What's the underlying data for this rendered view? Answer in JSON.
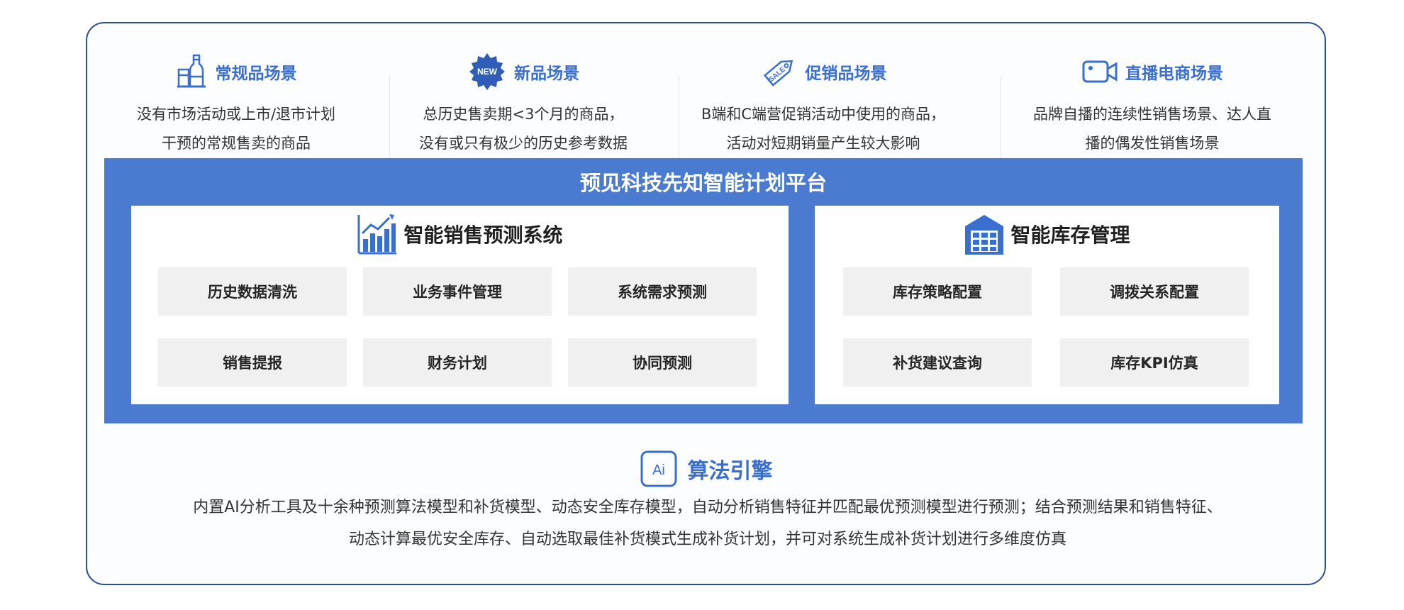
{
  "scenarios": [
    {
      "icon": "bottle-icon",
      "title": "常规品场景",
      "line1": "没有市场活动或上市/退市计划",
      "line2": "干预的常规售卖的商品"
    },
    {
      "icon": "new-badge-icon",
      "badge_text": "NEW",
      "title": "新品场景",
      "line1": "总历史售卖期<3个月的商品，",
      "line2": "没有或只有极少的历史参考数据"
    },
    {
      "icon": "sale-tag-icon",
      "tag_text": "SALE",
      "title": "促销品场景",
      "line1": "B端和C端营促销活动中使用的商品，",
      "line2": "活动对短期销量产生较大影响"
    },
    {
      "icon": "video-camera-icon",
      "title": "直播电商场景",
      "line1": "品牌自播的连续性销售场景、达人直",
      "line2": "播的偶发性销售场景"
    }
  ],
  "platform": {
    "title": "预见科技先知智能计划平台",
    "forecast": {
      "icon": "bar-chart-trend-icon",
      "title": "智能销售预测系统",
      "modules": [
        "历史数据清洗",
        "业务事件管理",
        "系统需求预测",
        "销售提报",
        "财务计划",
        "协同预测"
      ]
    },
    "inventory": {
      "icon": "warehouse-icon",
      "title": "智能库存管理",
      "modules": [
        "库存策略配置",
        "调拨关系配置",
        "补货建议查询",
        "库存KPI仿真"
      ]
    }
  },
  "engine": {
    "icon": "ai-chip-icon",
    "icon_text": "Ai",
    "title": "算法引擎",
    "line1": "内置AI分析工具及十余种预测算法模型和补货模型、动态安全库存模型，自动分析销售特征并匹配最优预测模型进行预测；结合预测结果和销售特征、",
    "line2": "动态计算最优安全库存、自动选取最佳补货模式生成补货计划，并可对系统生成补货计划进行多维度仿真"
  },
  "colors": {
    "accent": "#3a6fd0",
    "platform_blue": "#4a7bd1",
    "frame_border": "#2c4f8f",
    "module_bg": "#f0f0f0"
  }
}
